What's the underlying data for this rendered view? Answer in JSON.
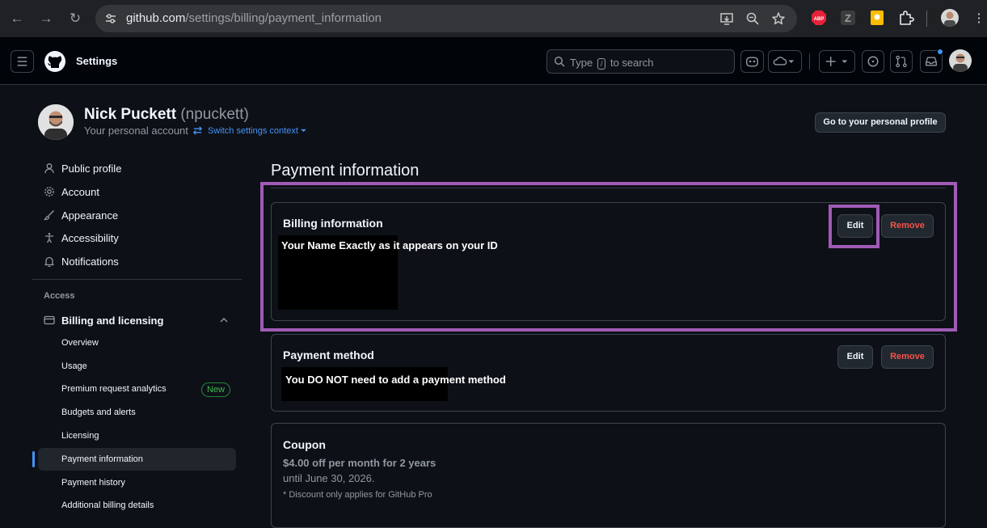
{
  "browser": {
    "url_host": "github.com",
    "url_path": "/settings/billing/payment_information",
    "extensions": [
      "abp-icon",
      "zotero-icon",
      "keep-icon",
      "puzzle-icon"
    ]
  },
  "header": {
    "title": "Settings",
    "search_prefix": "Type",
    "search_key": "/",
    "search_suffix": "to search"
  },
  "profile": {
    "name": "Nick Puckett",
    "handle": "(npuckett)",
    "subtitle": "Your personal account",
    "switch_label": "Switch settings context",
    "profile_button": "Go to your personal profile"
  },
  "sidebar": {
    "items": [
      {
        "label": "Public profile",
        "icon": "person-icon"
      },
      {
        "label": "Account",
        "icon": "gear-icon"
      },
      {
        "label": "Appearance",
        "icon": "paintbrush-icon"
      },
      {
        "label": "Accessibility",
        "icon": "accessibility-icon"
      },
      {
        "label": "Notifications",
        "icon": "bell-icon"
      }
    ],
    "section_label": "Access",
    "billing_label": "Billing and licensing",
    "billing_sub": [
      "Overview",
      "Usage",
      "Premium request analytics",
      "Budgets and alerts",
      "Licensing",
      "Payment information",
      "Payment history",
      "Additional billing details"
    ],
    "new_badge": "New",
    "active_item": "Payment information"
  },
  "main": {
    "title": "Payment information",
    "billing_card": {
      "title": "Billing information",
      "overlay_text": "Your Name Exactly as it appears on your ID",
      "edit_label": "Edit",
      "remove_label": "Remove"
    },
    "payment_card": {
      "title": "Payment method",
      "overlay_text": "You DO NOT need to add a payment method",
      "edit_label": "Edit",
      "remove_label": "Remove"
    },
    "coupon_card": {
      "title": "Coupon",
      "discount": "$4.00 off per month for 2 years",
      "until": "until June 30, 2026.",
      "note": "* Discount only applies for GitHub Pro"
    }
  },
  "colors": {
    "highlight": "#a05bb5",
    "accent": "#4493f8",
    "danger": "#f85149",
    "success": "#3fb950"
  }
}
